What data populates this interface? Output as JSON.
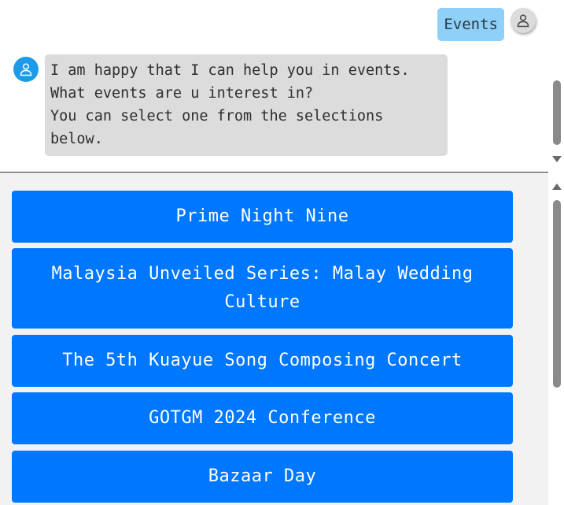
{
  "chat": {
    "user_message": "Events",
    "bot_message": "I am happy that I can help you in events.\nWhat events are u interest in?\nYou can select one from the selections below."
  },
  "options": [
    {
      "label": "Prime Night Nine"
    },
    {
      "label": "Malaysia Unveiled Series: Malay Wedding Culture"
    },
    {
      "label": "The 5th Kuayue Song Composing Concert"
    },
    {
      "label": "GOTGM 2024 Conference"
    },
    {
      "label": "Bazaar Day"
    }
  ],
  "colors": {
    "user_bubble": "#8fd0f8",
    "bot_bubble": "#dcdcdc",
    "bot_avatar": "#1e9be8",
    "option_button": "#0077ff",
    "options_background": "#f2f2f2"
  },
  "icons": {
    "user_avatar": "person-icon",
    "bot_avatar": "person-icon"
  }
}
